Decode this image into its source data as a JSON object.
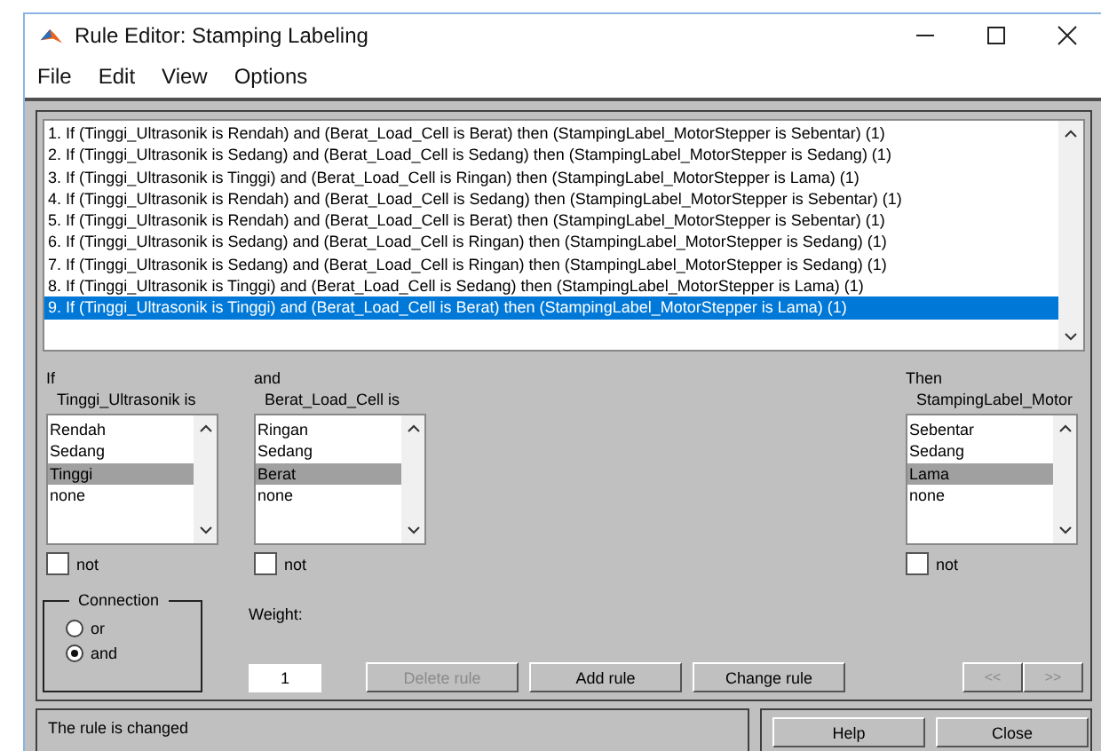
{
  "window": {
    "title": "Rule Editor: Stamping Labeling"
  },
  "menu": [
    "File",
    "Edit",
    "View",
    "Options"
  ],
  "rules": [
    {
      "text": "1. If (Tinggi_Ultrasonik is Rendah) and (Berat_Load_Cell is Berat) then (StampingLabel_MotorStepper is Sebentar) (1)",
      "selected": false
    },
    {
      "text": "2. If (Tinggi_Ultrasonik is Sedang) and (Berat_Load_Cell is Sedang) then (StampingLabel_MotorStepper is Sedang) (1)",
      "selected": false
    },
    {
      "text": "3. If (Tinggi_Ultrasonik is Tinggi) and (Berat_Load_Cell is Ringan) then (StampingLabel_MotorStepper is Lama) (1)",
      "selected": false
    },
    {
      "text": "4. If (Tinggi_Ultrasonik is Rendah) and (Berat_Load_Cell is Sedang) then (StampingLabel_MotorStepper is Sebentar) (1)",
      "selected": false
    },
    {
      "text": "5. If (Tinggi_Ultrasonik is Rendah) and (Berat_Load_Cell is Berat) then (StampingLabel_MotorStepper is Sebentar) (1)",
      "selected": false
    },
    {
      "text": "6. If (Tinggi_Ultrasonik is Sedang) and (Berat_Load_Cell is Ringan) then (StampingLabel_MotorStepper is Sedang) (1)",
      "selected": false
    },
    {
      "text": "7. If (Tinggi_Ultrasonik is Sedang) and (Berat_Load_Cell is Ringan) then (StampingLabel_MotorStepper is Sedang) (1)",
      "selected": false
    },
    {
      "text": "8. If (Tinggi_Ultrasonik is Tinggi) and (Berat_Load_Cell is Sedang) then (StampingLabel_MotorStepper is Lama) (1)",
      "selected": false
    },
    {
      "text": "9. If (Tinggi_Ultrasonik is Tinggi) and (Berat_Load_Cell is Berat) then (StampingLabel_MotorStepper is Lama) (1)",
      "selected": true
    }
  ],
  "variables": [
    {
      "keyword": "If",
      "name": "Tinggi_Ultrasonik is",
      "options": [
        {
          "label": "Rendah",
          "selected": false
        },
        {
          "label": "Sedang",
          "selected": false
        },
        {
          "label": "Tinggi",
          "selected": true
        },
        {
          "label": "none",
          "selected": false
        }
      ],
      "not_label": "not",
      "not_checked": false
    },
    {
      "keyword": "and",
      "name": "Berat_Load_Cell is",
      "options": [
        {
          "label": "Ringan",
          "selected": false
        },
        {
          "label": "Sedang",
          "selected": false
        },
        {
          "label": "Berat",
          "selected": true
        },
        {
          "label": "none",
          "selected": false
        }
      ],
      "not_label": "not",
      "not_checked": false
    },
    {
      "keyword": "Then",
      "name": "StampingLabel_Motor",
      "options": [
        {
          "label": "Sebentar",
          "selected": false
        },
        {
          "label": "Sedang",
          "selected": false
        },
        {
          "label": "Lama",
          "selected": true
        },
        {
          "label": "none",
          "selected": false
        }
      ],
      "not_label": "not",
      "not_checked": false
    }
  ],
  "connection": {
    "title": "Connection",
    "options": [
      {
        "label": "or",
        "selected": false
      },
      {
        "label": "and",
        "selected": true
      }
    ]
  },
  "weight": {
    "label": "Weight:",
    "value": "1"
  },
  "buttons": [
    {
      "label": "Delete rule",
      "disabled": true
    },
    {
      "label": "Add rule",
      "disabled": false
    },
    {
      "label": "Change rule",
      "disabled": false
    }
  ],
  "nav_buttons": [
    {
      "label": "<<",
      "disabled": true
    },
    {
      "label": ">>",
      "disabled": true
    }
  ],
  "status": "The rule is changed",
  "footer_buttons": [
    "Help",
    "Close"
  ]
}
